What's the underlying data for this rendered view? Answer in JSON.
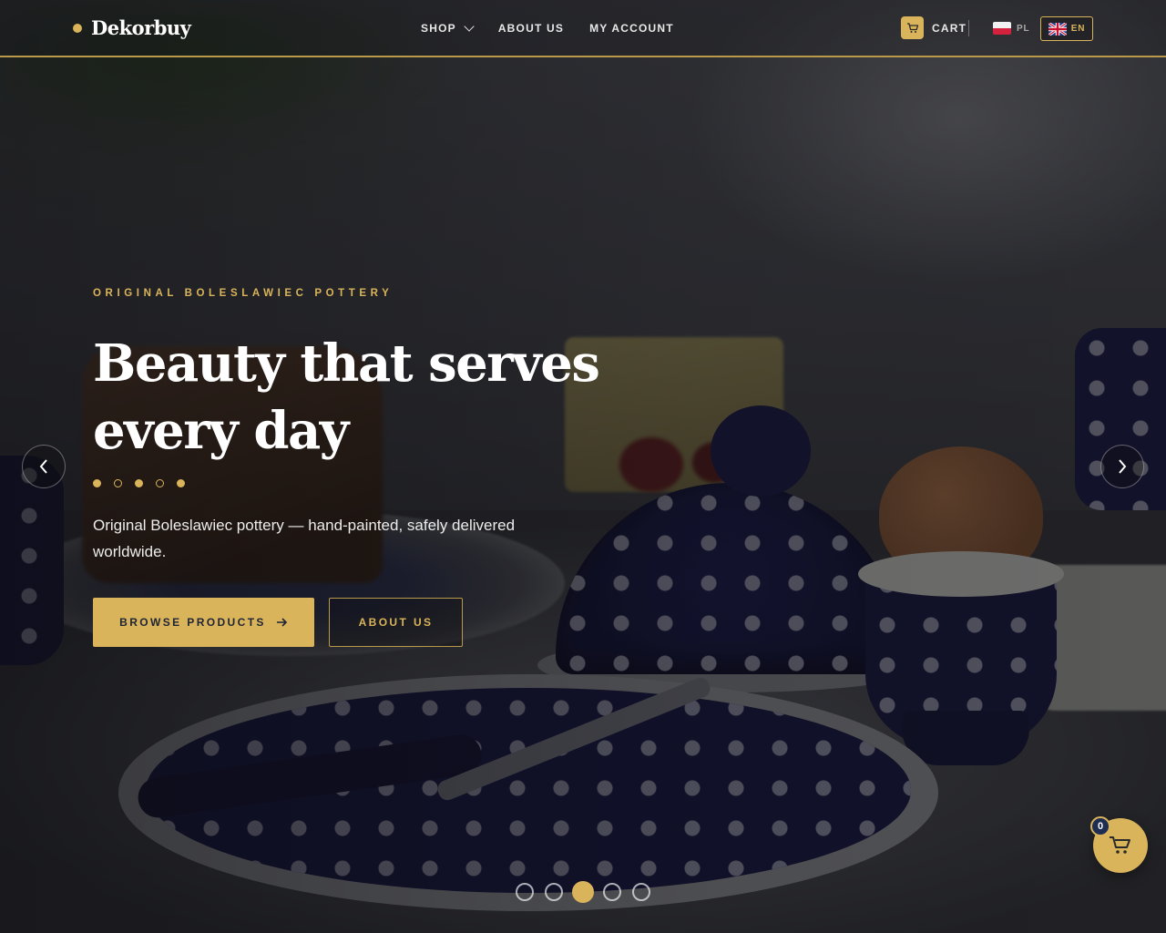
{
  "brand": {
    "name": "Dekorbuy",
    "accent_color": "#d9b45a"
  },
  "nav": {
    "shop": "SHOP",
    "about": "ABOUT US",
    "account": "MY ACCOUNT"
  },
  "cart": {
    "label": "CART",
    "icon": "cart-icon",
    "count": "0"
  },
  "languages": [
    {
      "code": "PL",
      "flag": "poland-flag-icon",
      "active": false
    },
    {
      "code": "EN",
      "flag": "uk-flag-icon",
      "active": true
    }
  ],
  "hero": {
    "eyebrow": "ORIGINAL BOLESLAWIEC POTTERY",
    "headline": "Beauty that serves every day",
    "subtitle": "Original Boleslawiec pottery — hand-painted, safely delivered worldwide.",
    "primary_cta": "BROWSE PRODUCTS",
    "secondary_cta": "ABOUT US"
  },
  "slider": {
    "total_slides": 5,
    "active_slide": 3
  }
}
